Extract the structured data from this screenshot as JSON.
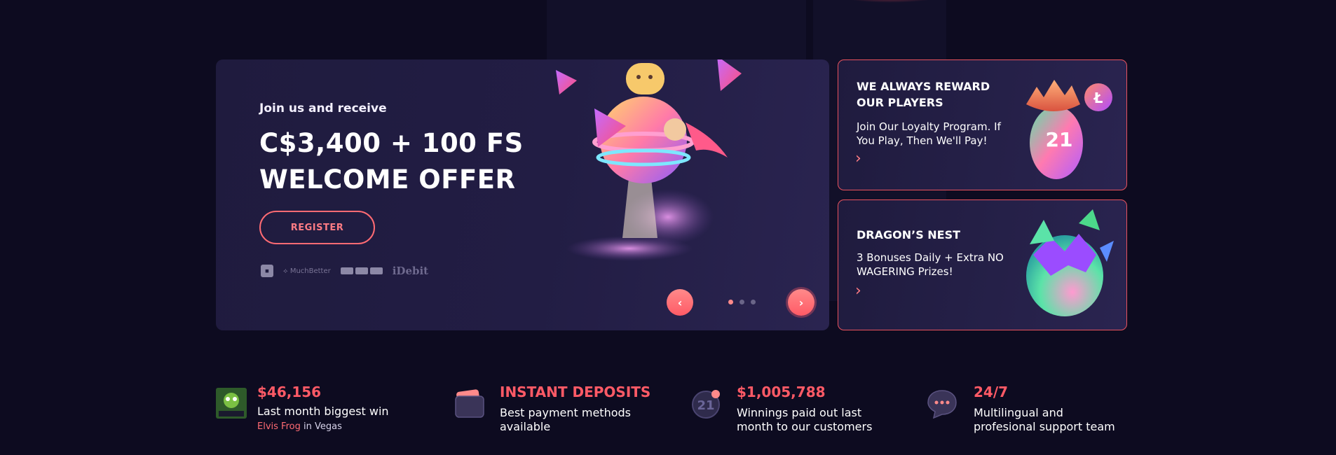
{
  "hero": {
    "subtitle": "Join us and receive",
    "amount": "C$3,400 + 100 FS",
    "offer": "WELCOME OFFER",
    "register_label": "REGISTER",
    "payment_methods": [
      "MuchBetter",
      "iDebit"
    ],
    "prev_label": "‹",
    "next_label": "›",
    "slides_total": 3,
    "active_slide": 1
  },
  "cards": [
    {
      "title_line1": "WE ALWAYS REWARD",
      "title_line2": "OUR PLAYERS",
      "text": "Join Our Loyalty Program. If You Play, Then We'll Pay!",
      "arrow": "›",
      "art_number": "21"
    },
    {
      "title_line1": "DRAGON’S NEST",
      "text": "3 Bonuses Daily + Extra NO WAGERING Prizes!",
      "arrow": "›"
    }
  ],
  "stats": [
    {
      "headline": "$46,156",
      "description": "Last month biggest win",
      "game": "Elvis Frog",
      "game_suffix": "in Vegas",
      "icon": "game-thumbnail"
    },
    {
      "headline": "INSTANT DEPOSITS",
      "description_line1": "Best payment methods",
      "description_line2": "available",
      "icon": "wallet-icon"
    },
    {
      "headline": "$1,005,788",
      "description_line1": "Winnings paid out last",
      "description_line2": "month to our customers",
      "icon": "coin-icon",
      "icon_number": "21"
    },
    {
      "headline": "24/7",
      "description_line1": "Multilingual and",
      "description_line2": "profesional support team",
      "icon": "chat-bubble-icon"
    }
  ],
  "colors": {
    "background": "#0d0b20",
    "panel": "#221d44",
    "accent": "#ff5a66",
    "border": "#e9535e"
  }
}
